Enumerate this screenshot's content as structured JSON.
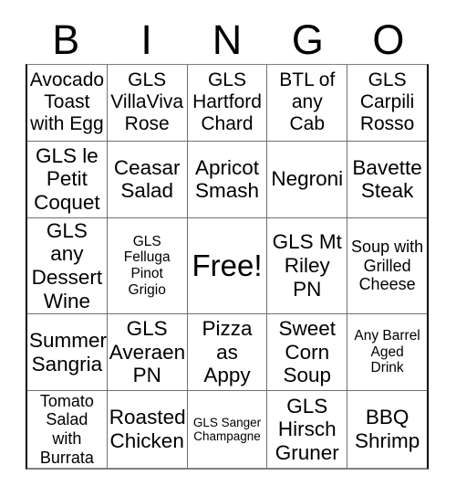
{
  "card": {
    "title": "BINGO",
    "free_space_label": "Free!",
    "header_letters": [
      "B",
      "I",
      "N",
      "G",
      "O"
    ],
    "columns": 5,
    "rows": 5,
    "colors": {
      "background": "#ffffff",
      "text": "#000000",
      "grid_line": "#707070",
      "outer_border": "#000000"
    },
    "cells": [
      [
        {
          "text": "Avocado\nToast\nwith Egg",
          "size": "lg",
          "free": false
        },
        {
          "text": "GLS\nVillaViva\nRose",
          "size": "lg",
          "free": false
        },
        {
          "text": "GLS\nHartford\nChard",
          "size": "lg",
          "free": false
        },
        {
          "text": "BTL of\nany\nCab",
          "size": "lg",
          "free": false
        },
        {
          "text": "GLS\nCarpili\nRosso",
          "size": "lg",
          "free": false
        }
      ],
      [
        {
          "text": "GLS le\nPetit\nCoquet",
          "size": "xl",
          "free": false
        },
        {
          "text": "Ceasar\nSalad",
          "size": "xl",
          "free": false
        },
        {
          "text": "Apricot\nSmash",
          "size": "xl",
          "free": false
        },
        {
          "text": "Negroni",
          "size": "xl",
          "free": false
        },
        {
          "text": "Bavette\nSteak",
          "size": "xl",
          "free": false
        }
      ],
      [
        {
          "text": "GLS any\nDessert\nWine",
          "size": "xl",
          "free": false
        },
        {
          "text": "GLS\nFelluga\nPinot\nGrigio",
          "size": "sm",
          "free": false
        },
        {
          "text": "Free!",
          "size": "free",
          "free": true
        },
        {
          "text": "GLS Mt\nRiley\nPN",
          "size": "xl",
          "free": false
        },
        {
          "text": "Soup with\nGrilled\nCheese",
          "size": "md",
          "free": false
        }
      ],
      [
        {
          "text": "Summer\nSangria",
          "size": "xl",
          "free": false
        },
        {
          "text": "GLS\nAveraen\nPN",
          "size": "xl",
          "free": false
        },
        {
          "text": "Pizza\nas\nAppy",
          "size": "xl",
          "free": false
        },
        {
          "text": "Sweet\nCorn\nSoup",
          "size": "xl",
          "free": false
        },
        {
          "text": "Any Barrel\nAged\nDrink",
          "size": "sm",
          "free": false
        }
      ],
      [
        {
          "text": "Tomato\nSalad with\nBurrata",
          "size": "md",
          "free": false
        },
        {
          "text": "Roasted\nChicken",
          "size": "xl",
          "free": false
        },
        {
          "text": "GLS Sanger\nChampagne",
          "size": "xs",
          "free": false
        },
        {
          "text": "GLS\nHirsch\nGruner",
          "size": "xl",
          "free": false
        },
        {
          "text": "BBQ\nShrimp",
          "size": "xl",
          "free": false
        }
      ]
    ]
  }
}
